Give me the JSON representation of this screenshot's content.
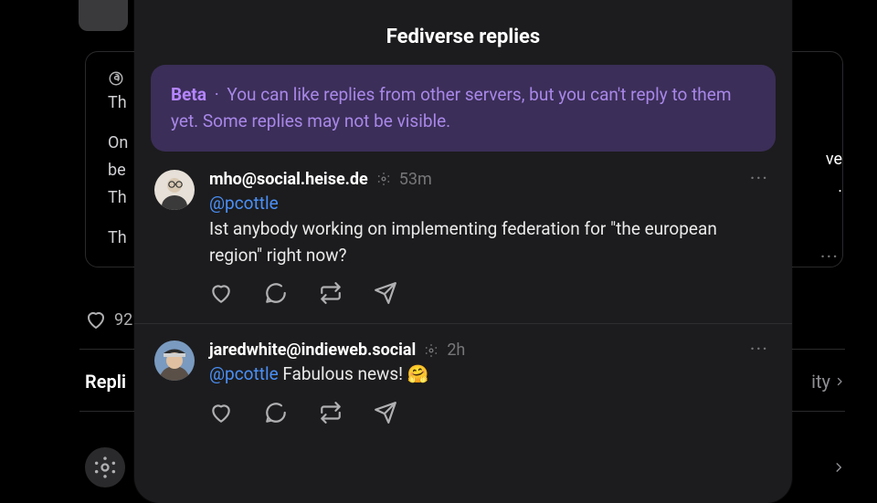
{
  "modal": {
    "title": "Fediverse replies",
    "beta": {
      "label": "Beta",
      "separator": "·",
      "text": "You can like replies from other servers, but you can't reply to them yet. Some replies may not be visible."
    },
    "replies": [
      {
        "handle": "mho@social.heise.de",
        "timestamp": "53m",
        "mention": "@pcottle",
        "body": "Ist anybody working on implementing federation for \"the european region\" right now?"
      },
      {
        "handle": "jaredwhite@indieweb.social",
        "timestamp": "2h",
        "mention": "@pcottle",
        "body_suffix": "Fabulous news! 🤗"
      }
    ]
  },
  "background": {
    "line1_prefix": "Th",
    "line2_prefix": "On",
    "line3_prefix": "be",
    "line4_prefix": "Th",
    "line5_prefix": "Th",
    "right_line1_suffix": "ve",
    "right_line2_suffix": ".",
    "like_count_partial": "92",
    "replies_label": "Repli",
    "activity_suffix": "ity",
    "more": "···"
  }
}
